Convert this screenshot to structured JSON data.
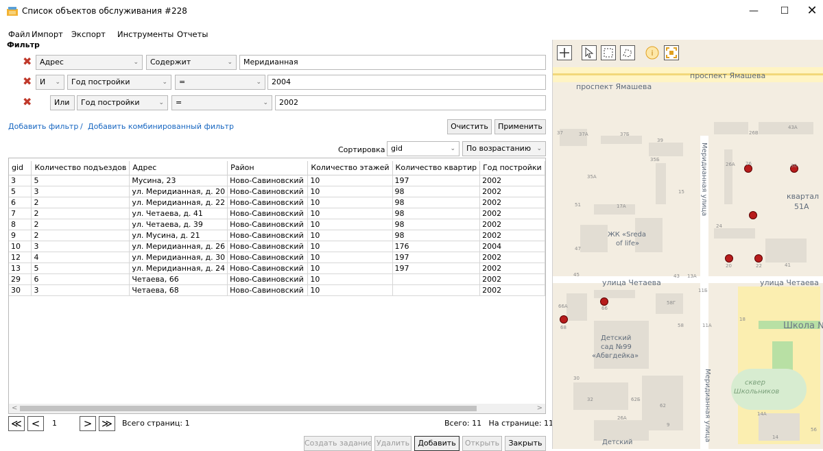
{
  "window": {
    "title": "Список объектов обслуживания #228",
    "minimize": "—",
    "maximize": "☐",
    "close": "✕"
  },
  "menu": [
    "Файл",
    "Импорт",
    "Экспорт",
    "Инструменты",
    "Отчеты"
  ],
  "filter": {
    "label": "Фильтр",
    "rows": [
      {
        "logic": "",
        "field": "Адрес",
        "op": "Содержит",
        "value": "Меридианная"
      },
      {
        "logic": "И",
        "field": "Год постройки",
        "op": "=",
        "value": "2004"
      },
      {
        "logic": "Или",
        "field": "Год постройки",
        "op": "=",
        "value": "2002"
      }
    ],
    "add_filter": "Добавить фильтр",
    "separator": "/",
    "add_combined": "Добавить комбинированный фильтр",
    "clear": "Очистить",
    "apply": "Применить"
  },
  "sort": {
    "label": "Сортировка",
    "field": "gid",
    "direction": "По возрастанию"
  },
  "table": {
    "columns": [
      "gid",
      "Количество подъездов",
      "Адрес",
      "Район",
      "Количество этажей",
      "Количество квартир",
      "Год постройки"
    ],
    "rows": [
      [
        "3",
        "5",
        "Мусина, 23",
        "Ново-Савиновский",
        "10",
        "197",
        "2002"
      ],
      [
        "5",
        "3",
        "ул. Меридианная, д. 20",
        "Ново-Савиновский",
        "10",
        "98",
        "2002"
      ],
      [
        "6",
        "2",
        "ул. Меридианная, д. 22",
        "Ново-Савиновский",
        "10",
        "98",
        "2002"
      ],
      [
        "7",
        "2",
        "ул. Четаева, д. 41",
        "Ново-Савиновский",
        "10",
        "98",
        "2002"
      ],
      [
        "8",
        "2",
        "ул. Четаева, д. 39",
        "Ново-Савиновский",
        "10",
        "98",
        "2002"
      ],
      [
        "9",
        "2",
        "ул. Мусина, д. 21",
        "Ново-Савиновский",
        "10",
        "98",
        "2002"
      ],
      [
        "10",
        "3",
        "ул. Меридианная, д. 26",
        "Ново-Савиновский",
        "10",
        "176",
        "2004"
      ],
      [
        "12",
        "4",
        "ул. Меридианная, д. 30",
        "Ново-Савиновский",
        "10",
        "197",
        "2002"
      ],
      [
        "13",
        "5",
        "ул. Меридианная, д. 24",
        "Ново-Савиновский",
        "10",
        "197",
        "2002"
      ],
      [
        "29",
        "6",
        "Четаева, 66",
        "Ново-Савиновский",
        "10",
        "",
        "2002"
      ],
      [
        "30",
        "3",
        "Четаева, 68",
        "Ново-Савиновский",
        "10",
        "",
        "2002"
      ]
    ]
  },
  "pager": {
    "first": "≪",
    "prev": "<",
    "page": "1",
    "next": ">",
    "last": "≫",
    "total_pages": "Всего страниц: 1",
    "summary": "Всего: 11   На странице: 11"
  },
  "actions": {
    "create_task": "Создать задание",
    "delete": "Удалить",
    "add": "Добавить",
    "open": "Открыть",
    "close": "Закрыть"
  },
  "map": {
    "tools": [
      "add-icon",
      "pointer-select-icon",
      "rect-select-icon",
      "lasso-select-icon",
      "info-icon",
      "zoom-extent-icon"
    ],
    "labels": {
      "street_top_1": "проспект Ямашева",
      "street_top_2": "проспект Ямашева",
      "street_vertical": "Меридианная улица",
      "street_vertical_2": "Меридианная улица",
      "street_mid": "улица Четаева",
      "street_mid_2": "улица Четаева",
      "kvartal": "квартал",
      "kvartal_num": "51А",
      "jk": "ЖК «Sreda",
      "jk2": "of life»",
      "kindergarten1": "Детский",
      "kindergarten2": "сад №99",
      "kindergarten3": "«Абвгдейка»",
      "school": "Школа №",
      "square1": "сквер",
      "square2": "Школьников",
      "bottom": "Детский"
    },
    "house_numbers": [
      "37",
      "37А",
      "37Б",
      "39",
      "35Б",
      "35А",
      "26В",
      "43А",
      "26А",
      "26",
      "30",
      "51",
      "17А",
      "15",
      "24",
      "47",
      "20",
      "22",
      "41",
      "45",
      "43",
      "13А",
      "11Б",
      "66А",
      "66",
      "58Г",
      "68",
      "58",
      "11А",
      "18",
      "30",
      "32",
      "62Б",
      "62",
      "26А",
      "9",
      "14А",
      "14",
      "56"
    ],
    "marker_color": "#b71c1c"
  }
}
